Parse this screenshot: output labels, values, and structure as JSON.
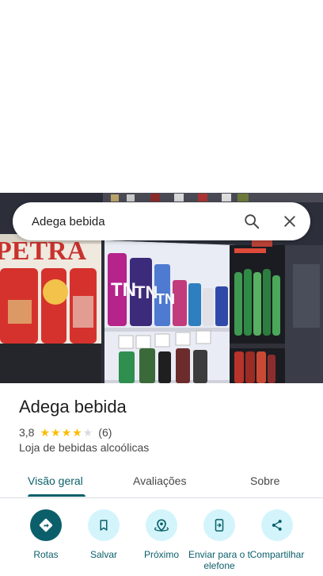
{
  "search": {
    "query": "Adega bebida"
  },
  "place": {
    "name": "Adega bebida",
    "rating": "3,8",
    "rating_value": 3.8,
    "review_count": "(6)",
    "category": "Loja de bebidas alcoólicas"
  },
  "photo": {
    "can_labels": [
      "PETRA",
      "TN"
    ]
  },
  "tabs": [
    {
      "label": "Visão geral",
      "active": true
    },
    {
      "label": "Avaliações",
      "active": false
    },
    {
      "label": "Sobre",
      "active": false
    }
  ],
  "actions": [
    {
      "label": "Rotas",
      "icon": "directions-icon"
    },
    {
      "label": "Salvar",
      "icon": "bookmark-icon"
    },
    {
      "label": "Próximo",
      "icon": "nearby-icon"
    },
    {
      "label": "Enviar para o telefone",
      "icon": "send-to-phone-icon"
    },
    {
      "label": "Compartilhar",
      "icon": "share-icon"
    }
  ],
  "colors": {
    "accent": "#0b5f6a",
    "action_bg": "#d3f4fb",
    "star": "#fbbc04"
  }
}
